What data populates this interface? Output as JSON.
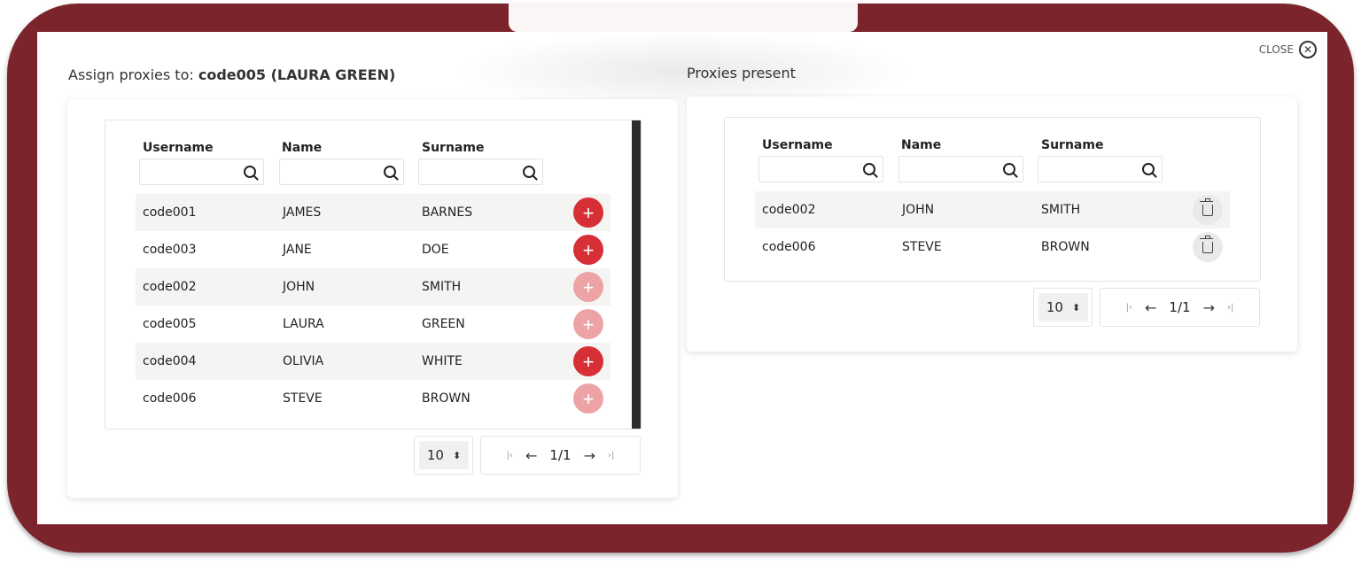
{
  "close_label": "CLOSE",
  "left": {
    "title_prefix": "Assign proxies to:",
    "title_bold": "code005 (LAURA GREEN)",
    "columns": {
      "username": "Username",
      "name": "Name",
      "surname": "Surname"
    },
    "rows": [
      {
        "username": "code001",
        "name": "JAMES",
        "surname": "BARNES",
        "add_enabled": true
      },
      {
        "username": "code003",
        "name": "JANE",
        "surname": "DOE",
        "add_enabled": true
      },
      {
        "username": "code002",
        "name": "JOHN",
        "surname": "SMITH",
        "add_enabled": false
      },
      {
        "username": "code005",
        "name": "LAURA",
        "surname": "GREEN",
        "add_enabled": false
      },
      {
        "username": "code004",
        "name": "OLIVIA",
        "surname": "WHITE",
        "add_enabled": true
      },
      {
        "username": "code006",
        "name": "STEVE",
        "surname": "BROWN",
        "add_enabled": false
      }
    ],
    "page_size": "10",
    "page_label": "1/1",
    "add_symbol": "+"
  },
  "right": {
    "title": "Proxies present",
    "columns": {
      "username": "Username",
      "name": "Name",
      "surname": "Surname"
    },
    "rows": [
      {
        "username": "code002",
        "name": "JOHN",
        "surname": "SMITH"
      },
      {
        "username": "code006",
        "name": "STEVE",
        "surname": "BROWN"
      }
    ],
    "page_size": "10",
    "page_label": "1/1"
  },
  "colors": {
    "frame": "#7c242b",
    "add_active": "#d62f35",
    "add_disabled": "#eda3a5",
    "row_alt": "#f4f4f2"
  }
}
